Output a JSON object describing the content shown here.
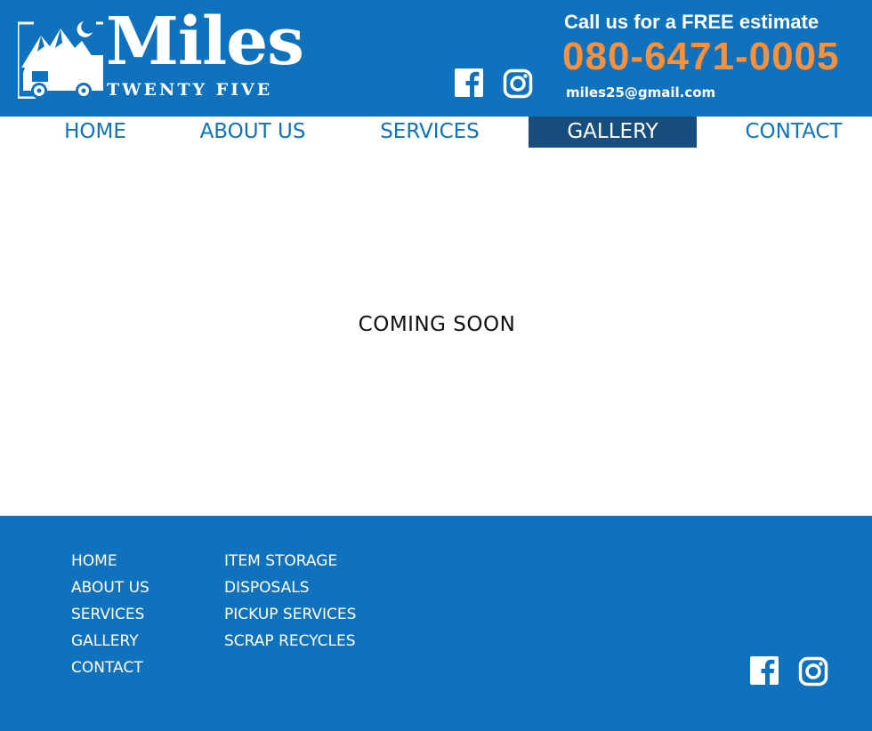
{
  "header": {
    "logo": {
      "title": "Miles",
      "subtitle": "TWENTY FIVE"
    },
    "cta": "Call us for a FREE estimate",
    "phone": "080-6471-0005",
    "email": "miles25@gmail.com",
    "social": [
      {
        "icon": "facebook-icon"
      },
      {
        "icon": "instagram-icon"
      }
    ]
  },
  "nav": {
    "items": [
      {
        "label": "HOME"
      },
      {
        "label": "ABOUT US"
      },
      {
        "label": "SERVICES"
      },
      {
        "label": "GALLERY",
        "active": true
      },
      {
        "label": "CONTACT"
      }
    ]
  },
  "main": {
    "message": "COMING SOON"
  },
  "footer": {
    "pages": [
      "HOME",
      "ABOUT US",
      "SERVICES",
      "GALLERY",
      "CONTACT"
    ],
    "services": [
      "ITEM STORAGE",
      "DISPOSALS",
      "PICKUP SERVICES",
      "SCRAP RECYCLES"
    ]
  },
  "colors": {
    "brand_blue": "#1072bc",
    "nav_active": "#174e7d",
    "phone_orange": "#f7913d",
    "white": "#ffffff"
  }
}
